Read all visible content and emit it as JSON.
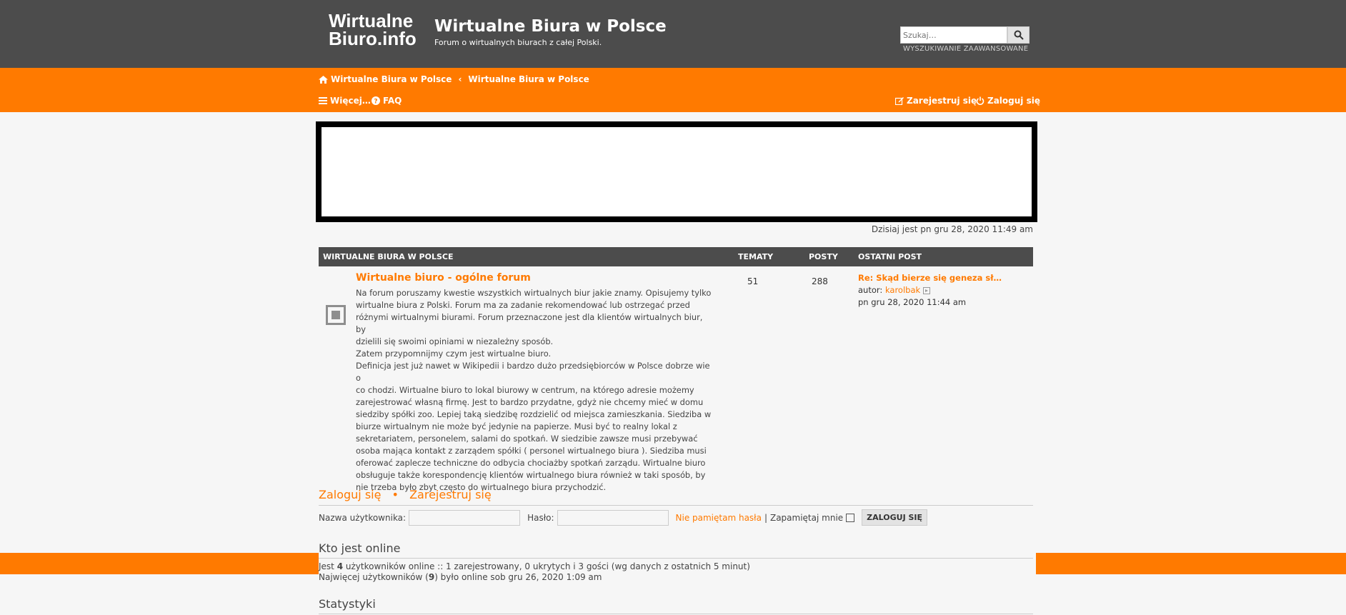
{
  "header": {
    "logo_line1": "Wirtualne",
    "logo_line2": "Biuro.info",
    "title": "Wirtualne Biura w Polsce",
    "description": "Forum o wirtualnych biurach z całej Polski.",
    "search_placeholder": "Szukaj…",
    "advanced_search": "WYSZUKIWANIE ZAAWANSOWANE"
  },
  "nav": {
    "breadcrumbs": [
      "Wirtualne Biura w Polsce",
      "Wirtualne Biura w Polsce"
    ],
    "more": "Więcej…",
    "faq": "FAQ",
    "register": "Zarejestruj się",
    "login": "Zaloguj się"
  },
  "today": "Dzisiaj jest pn gru 28, 2020 11:49 am",
  "forum_table": {
    "headers": [
      "WIRTUALNE BIURA W POLSCE",
      "TEMATY",
      "POSTY",
      "OSTATNI POST"
    ],
    "forum": {
      "title": "Wirtualne biuro - ogólne forum",
      "description_lines": [
        "Na forum poruszamy kwestie wszystkich wirtualnych biur jakie znamy. Opisujemy tylko",
        "wirtualne biura z Polski. Forum ma za zadanie rekomendować lub ostrzegać przed",
        "różnymi wirtualnymi biurami. Forum przeznaczone jest dla klientów wirtualnych biur, by",
        "dzielili się swoimi opiniami w niezależny sposób.",
        "Zatem przypomnijmy czym jest wirtualne biuro.",
        "Definicja jest już nawet w Wikipedii i bardzo dużo przedsiębiorców w Polsce dobrze wie o",
        "co chodzi. Wirtualne biuro to lokal biurowy w centrum, na którego adresie możemy",
        "zarejestrować własną firmę. Jest to bardzo przydatne, gdyż nie chcemy mieć w domu",
        "siedziby spółki zoo. Lepiej taką siedzibę rozdzielić od miejsca zamieszkania. Siedziba w",
        "biurze wirtualnym nie może być jedynie na papierze. Musi być to realny lokal z",
        "sekretariatem, personelem, salami do spotkań. W siedzibie zawsze musi przebywać",
        "osoba mająca kontakt z zarządem spółki ( personel wirtualnego biura ). Siedziba musi",
        "oferować zaplecze techniczne do odbycia chociażby spotkań zarządu. Wirtualne biuro",
        "obsługuje także korespondencję klientów wirtualnego biura również w taki sposób, by",
        "nie trzeba było zbyt często do wirtualnego biura przychodzić."
      ],
      "topics": "51",
      "posts": "288",
      "last_post_title": "Re: Skąd bierze się geneza sł…",
      "last_post_author_label": "autor:",
      "last_post_author": "karolbak",
      "last_post_time": "pn gru 28, 2020 11:44 am"
    }
  },
  "login_section": {
    "login_link": "Zaloguj się",
    "separator": "•",
    "register_link": "Zarejestruj się",
    "username_label": "Nazwa użytkownika:",
    "password_label": "Hasło:",
    "forgot_password": "Nie pamiętam hasła",
    "pipe": "|",
    "remember_me": "Zapamiętaj mnie",
    "login_button": "ZALOGUJ SIĘ"
  },
  "online": {
    "title": "Kto jest online",
    "line1_prefix": "Jest",
    "line1_count": "4",
    "line1_suffix": "użytkowników online :: 1 zarejestrowany, 0 ukrytych i 3 gości (wg danych z ostatnich 5 minut)",
    "line2_prefix": "Najwięcej użytkowników (",
    "line2_count": "9",
    "line2_suffix": ") było online sob gru 26, 2020 1:09 am"
  },
  "stats": {
    "title": "Statystyki"
  },
  "colors": {
    "header_bg": "#4c4c4c",
    "accent": "#ff7a00",
    "page_bg": "#f6f6f6"
  }
}
